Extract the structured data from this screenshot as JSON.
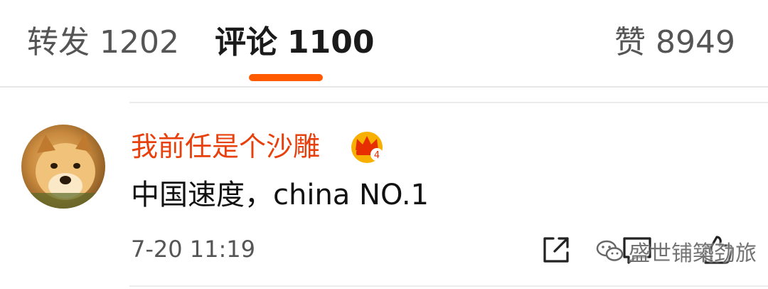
{
  "tabs": {
    "repost": {
      "label": "转发",
      "count": "1202"
    },
    "comments": {
      "label": "评论",
      "count": "1100"
    },
    "likes": {
      "label": "赞",
      "count": "8949"
    },
    "active": "comments",
    "accent_color": "#ff5a00"
  },
  "comment": {
    "username": "我前任是个沙雕",
    "badge_icon": "crown-level-icon",
    "badge_level": "4",
    "text": "中国速度，china NO.1",
    "timestamp": "7-20 11:19",
    "username_color": "#e8400c",
    "actions": [
      "share-icon",
      "reply-icon",
      "like-icon"
    ]
  },
  "watermark": {
    "text": "盛世铺築劲旅",
    "icon": "wechat-icon"
  }
}
